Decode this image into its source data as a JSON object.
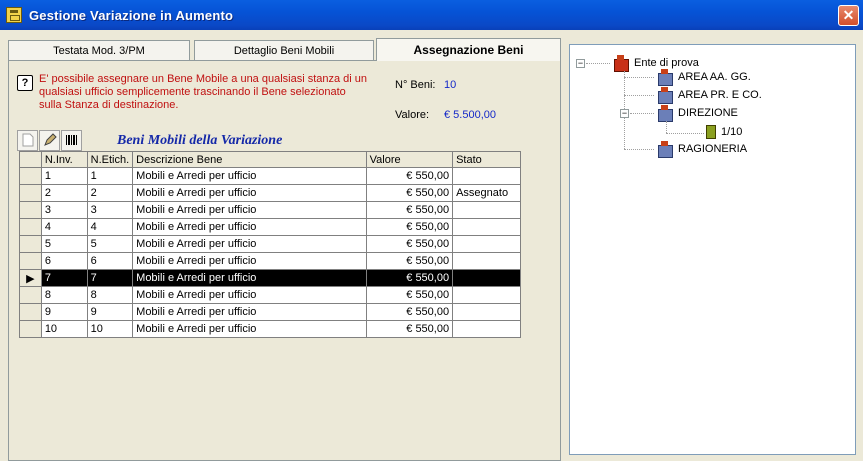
{
  "window": {
    "title": "Gestione Variazione in Aumento",
    "close_label": "✕"
  },
  "tabs": [
    {
      "label": "Testata Mod. 3/PM"
    },
    {
      "label": "Dettaglio Beni Mobili"
    },
    {
      "label": "Assegnazione Beni"
    }
  ],
  "help": {
    "icon": "?",
    "text": "E' possibile assegnare un Bene Mobile a una qualsiasi stanza di un qualsiasi ufficio semplicemente trascinando il Bene selezionato sulla Stanza di destinazione."
  },
  "summary": {
    "n_beni_label": "N° Beni:",
    "n_beni_value": "10",
    "valore_label": "Valore:",
    "valore_value": "€ 5.500,00"
  },
  "grid": {
    "title": "Beni Mobili della Variazione",
    "columns": [
      "N.Inv.",
      "N.Etich.",
      "Descrizione Bene",
      "Valore",
      "Stato"
    ],
    "selected_marker": "▶",
    "rows": [
      [
        "1",
        "1",
        "Mobili e Arredi per ufficio",
        "€ 550,00",
        ""
      ],
      [
        "2",
        "2",
        "Mobili e Arredi per ufficio",
        "€ 550,00",
        "Assegnato"
      ],
      [
        "3",
        "3",
        "Mobili e Arredi per ufficio",
        "€ 550,00",
        ""
      ],
      [
        "4",
        "4",
        "Mobili e Arredi per ufficio",
        "€ 550,00",
        ""
      ],
      [
        "5",
        "5",
        "Mobili e Arredi per ufficio",
        "€ 550,00",
        ""
      ],
      [
        "6",
        "6",
        "Mobili e Arredi per ufficio",
        "€ 550,00",
        ""
      ],
      [
        "7",
        "7",
        "Mobili e Arredi per ufficio",
        "€ 550,00",
        ""
      ],
      [
        "8",
        "8",
        "Mobili e Arredi per ufficio",
        "€ 550,00",
        ""
      ],
      [
        "9",
        "9",
        "Mobili e Arredi per ufficio",
        "€ 550,00",
        ""
      ],
      [
        "10",
        "10",
        "Mobili e Arredi per ufficio",
        "€ 550,00",
        ""
      ]
    ],
    "selected_row": 6
  },
  "tree": {
    "root": "Ente di prova",
    "children": [
      "AREA AA. GG.",
      "AREA PR. E CO.",
      "DIREZIONE",
      "RAGIONERIA"
    ],
    "direzione_child": "1/10",
    "collapse_glyph": "−"
  },
  "colors": {
    "accent": "#0A5FE0",
    "help_text": "#C01010",
    "value_text": "#1428C8"
  }
}
